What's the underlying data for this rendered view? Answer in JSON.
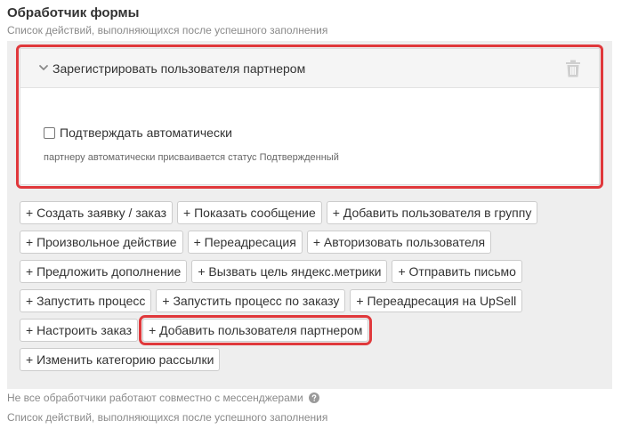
{
  "section": {
    "title": "Обработчик формы",
    "subtitle": "Список действий, выполняющихся после успешного заполнения"
  },
  "action_card": {
    "title": "Зарегистрировать пользователя партнером",
    "checkbox_label": "Подтверждать автоматически",
    "checkbox_checked": false,
    "hint": "партнеру автоматически присваивается статус Подтвержденный"
  },
  "actions": {
    "row0": {
      "b0": "+ Создать заявку / заказ",
      "b1": "+ Показать сообщение",
      "b2": "+ Добавить пользователя в группу"
    },
    "row1": {
      "b0": "+ Произвольное действие",
      "b1": "+ Переадресация",
      "b2": "+ Авторизовать пользователя"
    },
    "row2": {
      "b0": "+ Предложить дополнение",
      "b1": "+ Вызвать цель яндекс.метрики",
      "b2": "+ Отправить письмо"
    },
    "row3": {
      "b0": "+ Запустить процесс",
      "b1": "+ Запустить процесс по заказу",
      "b2": "+ Переадресация на UpSell"
    },
    "row4": {
      "b0": "+ Настроить заказ",
      "b1": "+ Добавить пользователя партнером"
    },
    "row5": {
      "b0": "+ Изменить категорию рассылки"
    }
  },
  "footer": {
    "note": "Не все обработчики работают совместно с мессенджерами",
    "description": "Список действий, выполняющихся после успешного заполнения"
  },
  "colors": {
    "highlight": "#e0383b",
    "panel_bg": "#eeeeee",
    "card_header_bg": "#f5f5f5",
    "muted_text": "#8a8a8a"
  },
  "icons": {
    "collapse": "chevron-down-icon",
    "delete": "trash-icon",
    "help": "question-circle-icon"
  }
}
